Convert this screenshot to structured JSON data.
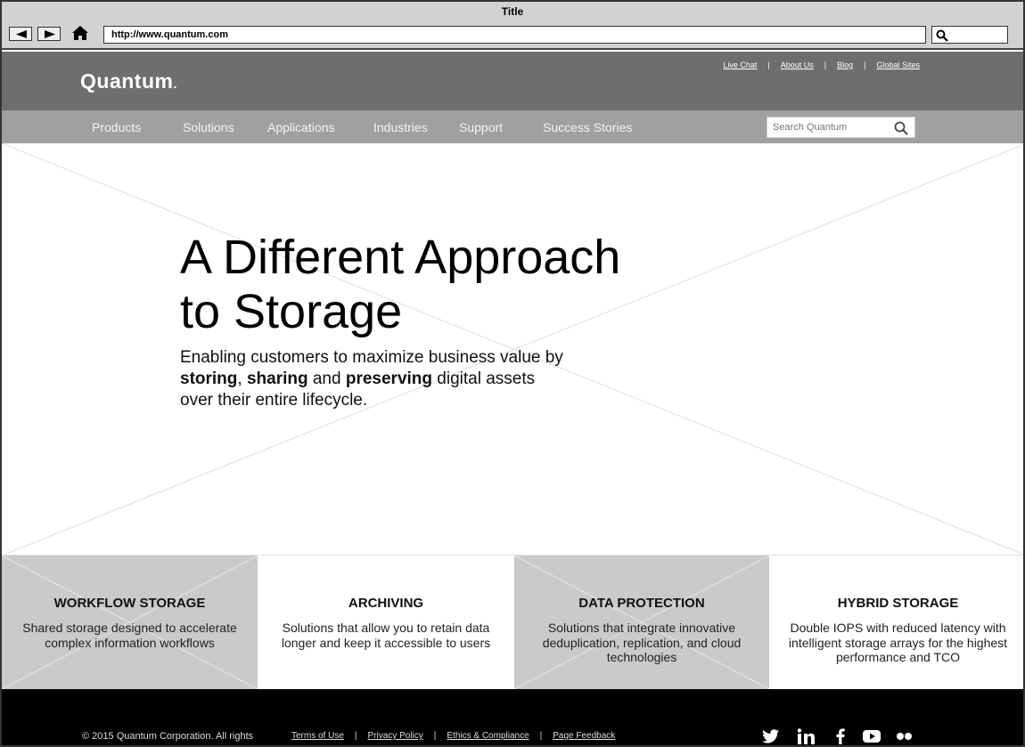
{
  "window": {
    "title": "Title"
  },
  "browser": {
    "url": "http://www.quantum.com"
  },
  "header": {
    "logo": "Quantum",
    "logo_dot": ".",
    "util_links": [
      "Live Chat",
      "About Us",
      "Blog",
      "Global Sites"
    ],
    "separator": "|"
  },
  "nav": {
    "items": [
      "Products",
      "Solutions",
      "Applications",
      "Industries",
      "Support",
      "Success Stories"
    ],
    "search_placeholder": "Search Quantum"
  },
  "hero": {
    "title_line1": "A Different Approach",
    "title_line2": "to Storage",
    "sub_part1": "Enabling customers to maximize business value by ",
    "sub_b1": "storing",
    "sub_part2": ", ",
    "sub_b2": "sharing",
    "sub_part3": " and ",
    "sub_b3": "preserving",
    "sub_part4": " digital assets over their entire lifecycle."
  },
  "tiles": [
    {
      "title": "WORKFLOW STORAGE",
      "text": "Shared storage designed to accelerate complex information workflows"
    },
    {
      "title": "ARCHIVING",
      "text": "Solutions that allow you to retain data longer and keep it accessible to users"
    },
    {
      "title": "DATA PROTECTION",
      "text": "Solutions that integrate innovative deduplication, replication, and cloud technologies"
    },
    {
      "title": "HYBRID STORAGE",
      "text": "Double IOPS with reduced latency with intelligent storage arrays for the highest performance and TCO"
    }
  ],
  "footer": {
    "copyright": "© 2015 Quantum Corporation. All rights",
    "links": [
      "Terms of Use",
      "Privacy Policy",
      "Ethics & Compliance",
      "Page Feedback"
    ],
    "social": [
      "twitter-icon",
      "linkedin-icon",
      "facebook-icon",
      "youtube-icon",
      "flickr-icon"
    ]
  }
}
